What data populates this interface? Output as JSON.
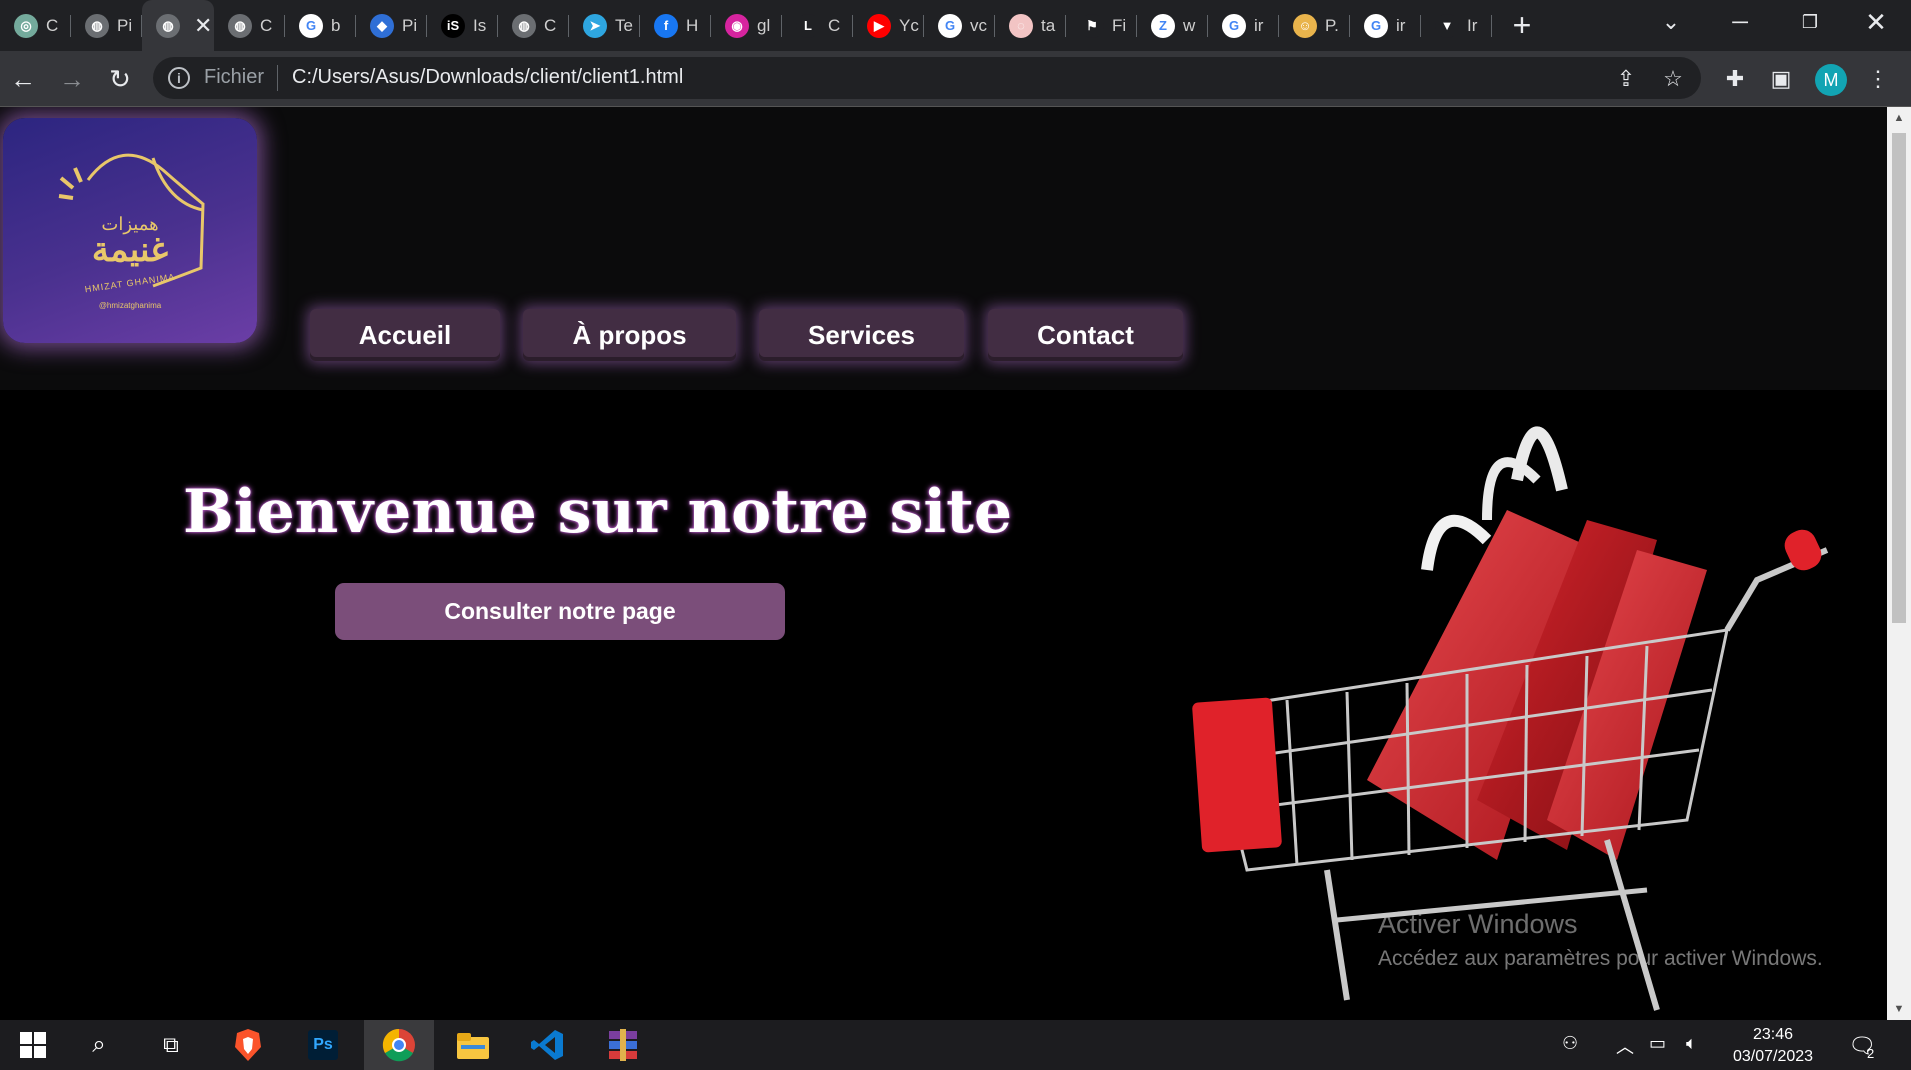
{
  "browser": {
    "tabs": [
      {
        "icon": "chatgpt-icon",
        "title": "C",
        "color": "#74aa9c",
        "glyph": "◎"
      },
      {
        "icon": "globe-icon",
        "title": "Pi",
        "color": "#6b6e72",
        "glyph": "◍"
      },
      {
        "icon": "globe-icon",
        "title": "",
        "color": "#6b6e72",
        "glyph": "◍",
        "active": true
      },
      {
        "icon": "globe-icon",
        "title": "C",
        "color": "#6b6e72",
        "glyph": "◍"
      },
      {
        "icon": "google-icon",
        "title": "b",
        "color": "#ffffff",
        "glyph": "G"
      },
      {
        "icon": "robot-icon",
        "title": "Pi",
        "color": "#2f6fd6",
        "glyph": "◆"
      },
      {
        "icon": "is-icon",
        "title": "Is",
        "color": "#000000",
        "glyph": "iS"
      },
      {
        "icon": "globe-icon",
        "title": "C",
        "color": "#6b6e72",
        "glyph": "◍"
      },
      {
        "icon": "telegram-icon",
        "title": "Te",
        "color": "#2ea6e0",
        "glyph": "➤"
      },
      {
        "icon": "facebook-icon",
        "title": "H",
        "color": "#1877f2",
        "glyph": "f"
      },
      {
        "icon": "instagram-icon",
        "title": "gl",
        "color": "#d6249f",
        "glyph": "◉"
      },
      {
        "icon": "l-icon",
        "title": "C",
        "color": "#202124",
        "glyph": "L"
      },
      {
        "icon": "youtube-icon",
        "title": "Yc",
        "color": "#ff0000",
        "glyph": "▶"
      },
      {
        "icon": "google-icon",
        "title": "vc",
        "color": "#ffffff",
        "glyph": "G"
      },
      {
        "icon": "circle-icon",
        "title": "ta",
        "color": "#f2c4c4",
        "glyph": "◌"
      },
      {
        "icon": "flag-icon",
        "title": "Fi",
        "color": "#202124",
        "glyph": "⚑"
      },
      {
        "icon": "z-icon",
        "title": "w",
        "color": "#ffffff",
        "glyph": "Z"
      },
      {
        "icon": "google-icon",
        "title": "ir",
        "color": "#ffffff",
        "glyph": "G"
      },
      {
        "icon": "emoji-icon",
        "title": "P.",
        "color": "#e9b44c",
        "glyph": "☺"
      },
      {
        "icon": "google-icon",
        "title": "ir",
        "color": "#ffffff",
        "glyph": "G"
      },
      {
        "icon": "v-icon",
        "title": "Ir",
        "color": "#202124",
        "glyph": "▼"
      }
    ],
    "scheme": "Fichier",
    "url": "C:/Users/Asus/Downloads/client/client1.html",
    "profile_initial": "M"
  },
  "site": {
    "logo": {
      "arabic_top": "هميزات",
      "arabic_main": "غنيمة",
      "latin": "HMIZAT GHANIMA",
      "handle": "@hmizatghanima"
    },
    "nav": [
      "Accueil",
      "À propos",
      "Services",
      "Contact"
    ],
    "hero_title": "Bienvenue sur notre site",
    "cta_label": "Consulter notre page"
  },
  "watermark": {
    "title": "Activer Windows",
    "subtitle": "Accédez aux paramètres pour activer Windows."
  },
  "taskbar": {
    "time": "23:46",
    "date": "03/07/2023",
    "notifications": "2"
  },
  "colors": {
    "nav_button": "#422d43",
    "cta_button": "#7b4e7a",
    "logo_gold": "#e8c76a",
    "cart_red": "#e0222a"
  }
}
